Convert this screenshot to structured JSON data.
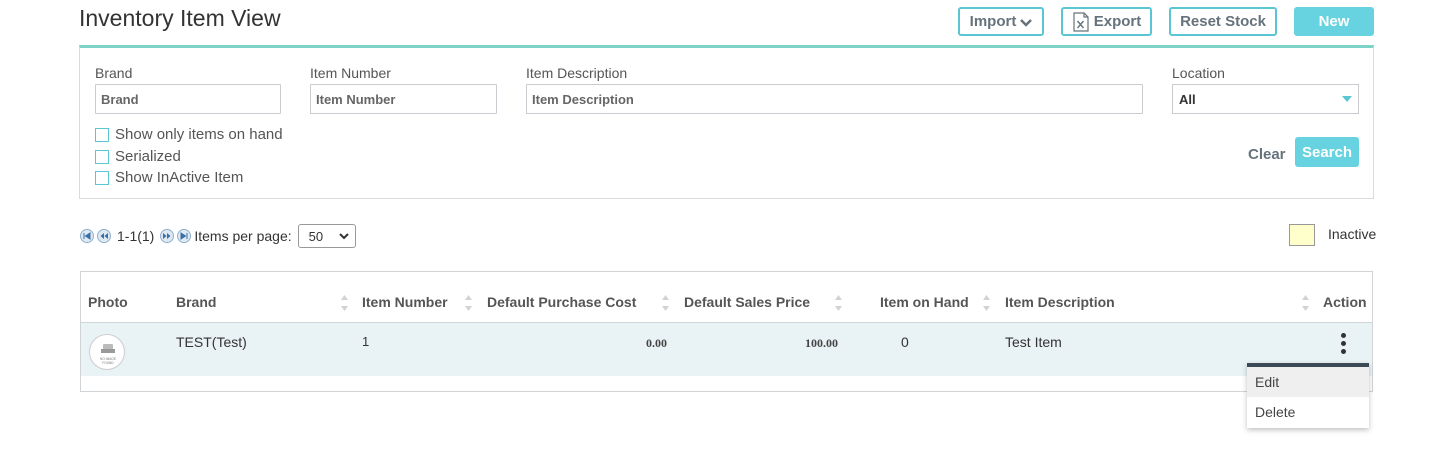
{
  "header": {
    "title": "Inventory Item View",
    "import_label": "Import",
    "export_label": "Export",
    "reset_stock_label": "Reset Stock",
    "new_label": "New"
  },
  "filters": {
    "brand_label": "Brand",
    "brand_placeholder": "Brand",
    "item_number_label": "Item Number",
    "item_number_placeholder": "Item Number",
    "item_description_label": "Item Description",
    "item_description_placeholder": "Item Description",
    "location_label": "Location",
    "location_value": "All",
    "checkboxes": [
      {
        "label": "Show only items on hand",
        "checked": false
      },
      {
        "label": "Serialized",
        "checked": false
      },
      {
        "label": "Show InActive Item",
        "checked": false
      }
    ],
    "clear_label": "Clear",
    "search_label": "Search"
  },
  "pager": {
    "range_text": "1-1(1)",
    "items_per_page_label": "Items per page:",
    "items_per_page_value": "50"
  },
  "legend": {
    "inactive_label": "Inactive",
    "inactive_color": "#ffffcc"
  },
  "grid": {
    "columns": [
      "Photo",
      "Brand",
      "Item Number",
      "Default Purchase Cost",
      "Default Sales Price",
      "Item on Hand",
      "Item Description",
      "Action"
    ],
    "rows": [
      {
        "photo_text": "NO IMAGE FOUND",
        "brand": "TEST(Test)",
        "item_number": "1",
        "default_purchase_cost": "0.00",
        "default_sales_price": "100.00",
        "item_on_hand": "0",
        "item_description": "Test Item"
      }
    ]
  },
  "action_menu": {
    "items": [
      "Edit",
      "Delete"
    ]
  },
  "colors": {
    "accent": "#5bc6d3",
    "primary_button": "#67d3e0",
    "row_bg": "#e9f2f5",
    "panel_top_border": "#7ed3c9"
  }
}
